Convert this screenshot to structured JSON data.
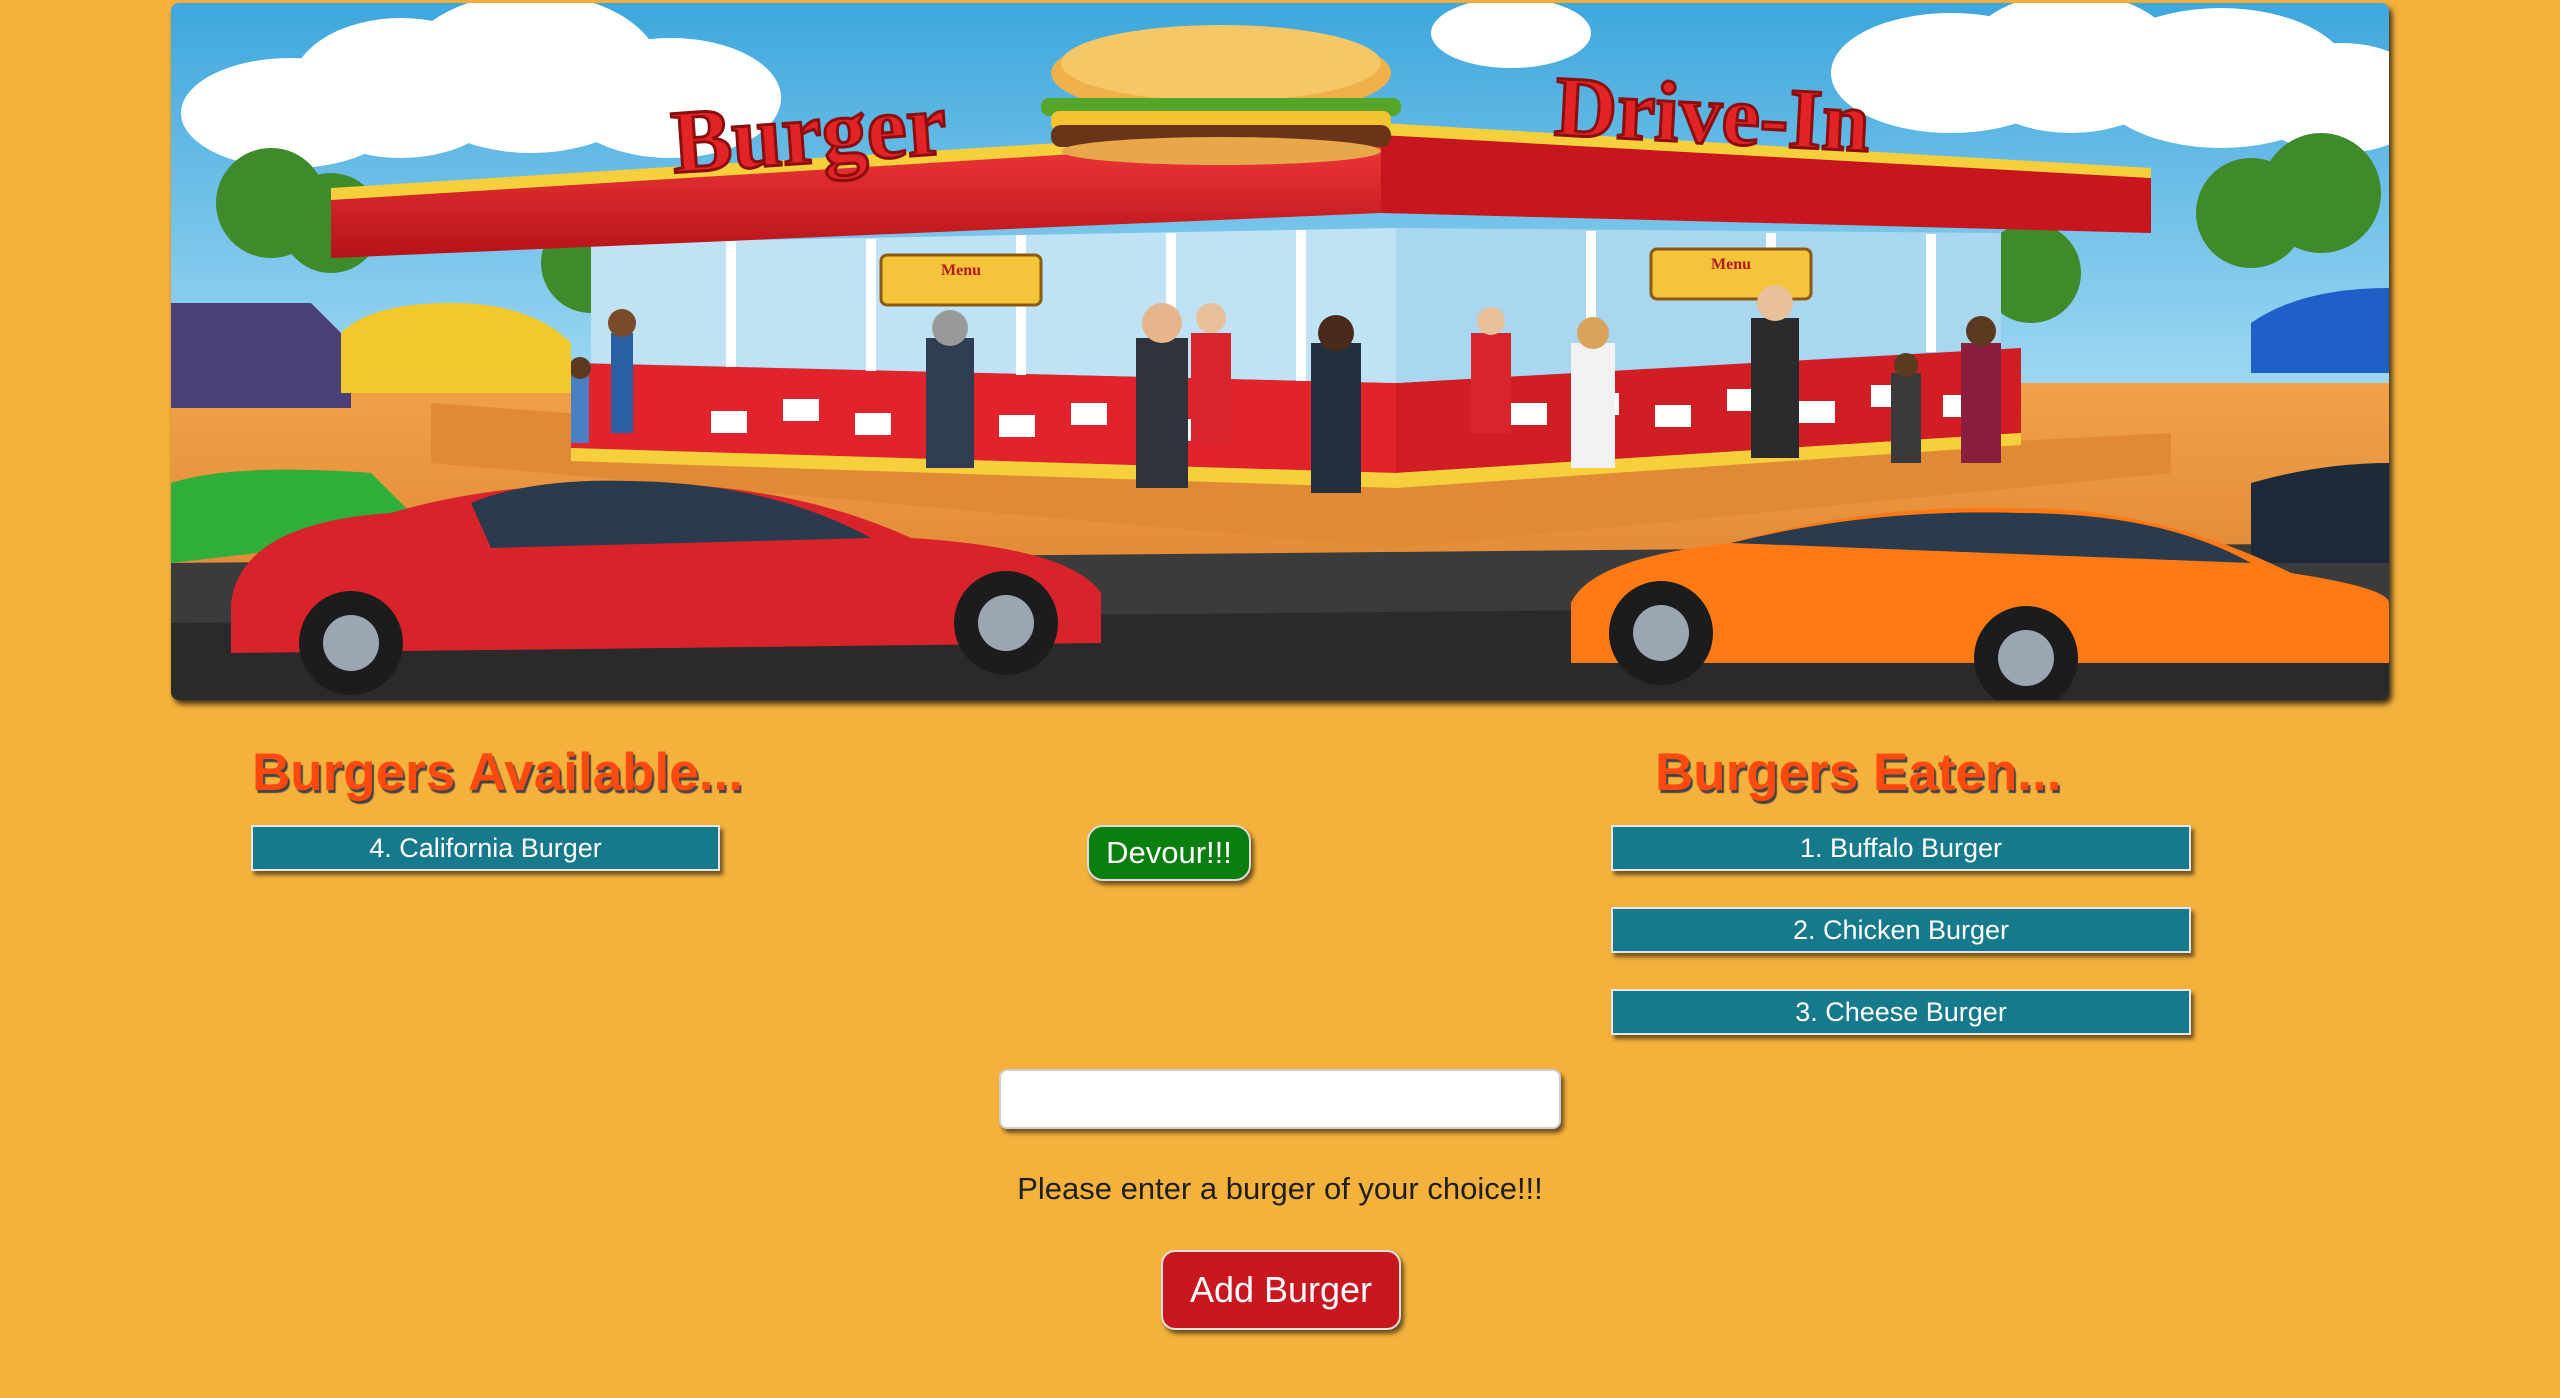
{
  "banner": {
    "sign_left": "Burger",
    "sign_right": "Drive-In",
    "menu_board_text": "Menu"
  },
  "available": {
    "heading": "Burgers Available...",
    "items": [
      "4. California Burger"
    ]
  },
  "eaten": {
    "heading": "Burgers Eaten...",
    "items": [
      "1. Buffalo Burger",
      "2. Chicken Burger",
      "3. Cheese Burger"
    ]
  },
  "devour_button_label": "Devour!!!",
  "add_form": {
    "input_value": "",
    "prompt": "Please enter a burger of your choice!!!",
    "submit_label": "Add Burger"
  },
  "colors": {
    "page_background": "#f4b13c",
    "heading": "#ff4a0f",
    "burger_item": "#167a8c",
    "devour_button": "#0b7e10",
    "add_button": "#c9171f"
  }
}
